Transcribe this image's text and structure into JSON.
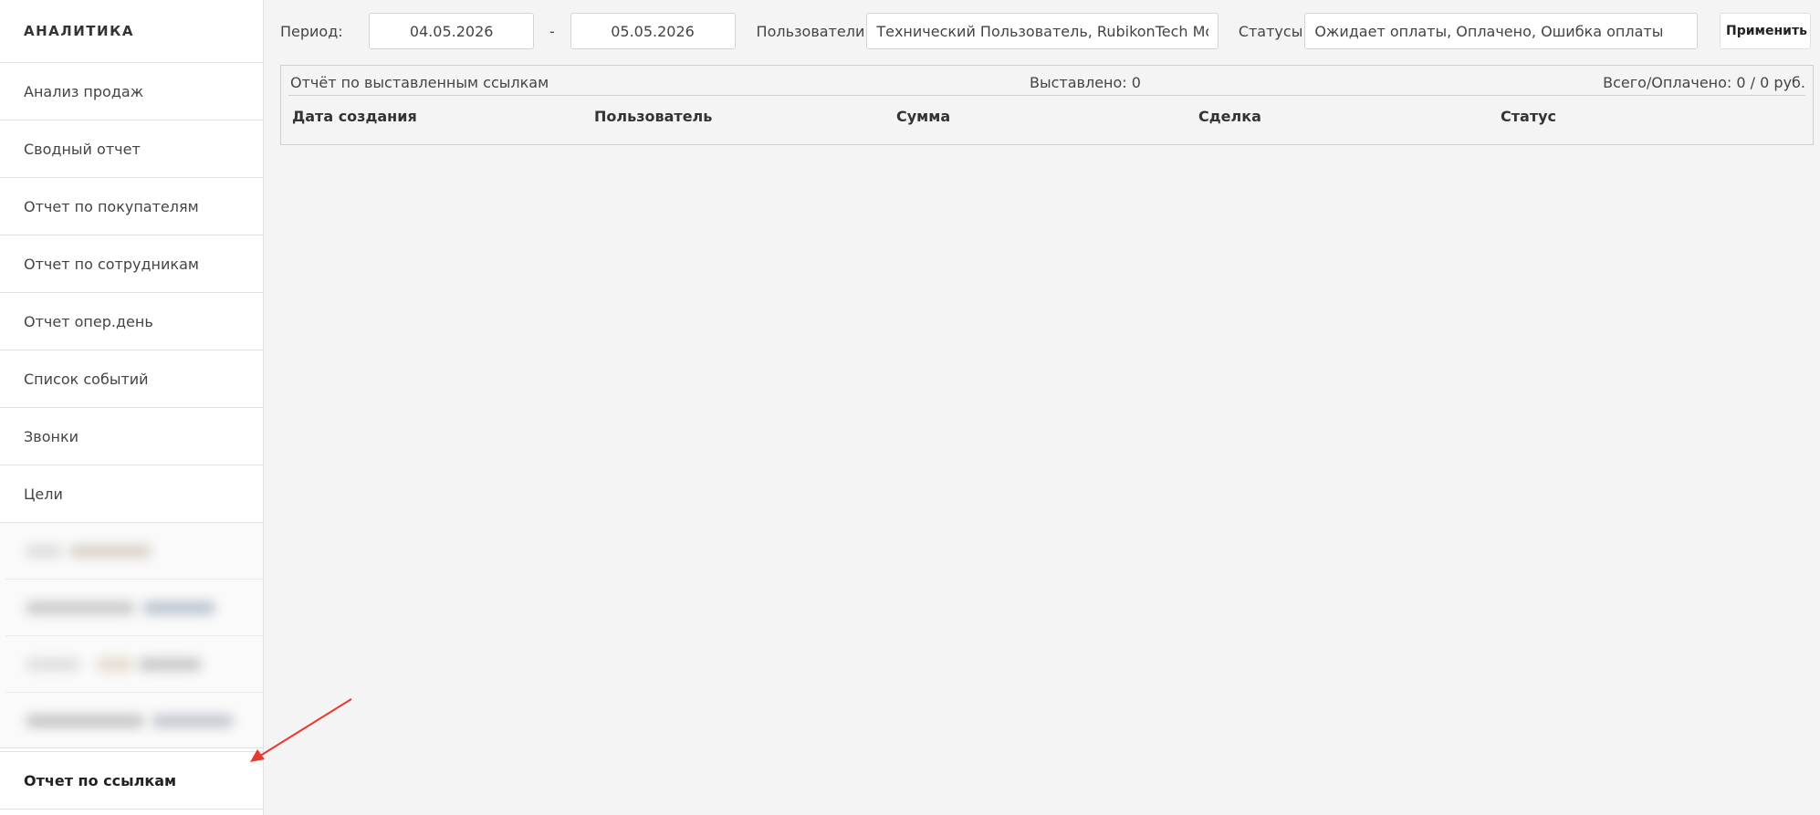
{
  "sidebar": {
    "title": "АНАЛИТИКА",
    "items": [
      {
        "label": "Анализ продаж"
      },
      {
        "label": "Сводный отчет"
      },
      {
        "label": "Отчет по покупателям"
      },
      {
        "label": "Отчет по сотрудникам"
      },
      {
        "label": "Отчет опер.день"
      },
      {
        "label": "Список событий"
      },
      {
        "label": "Звонки"
      },
      {
        "label": "Цели"
      }
    ],
    "active_item": {
      "label": "Отчет по ссылкам"
    }
  },
  "filters": {
    "period_label": "Период:",
    "date_from": "04.05.2026",
    "separator": "-",
    "date_to": "05.05.2026",
    "users_label": "Пользователи",
    "users_value": "Технический Пользователь, RubikonTech Модерация",
    "statuses_label": "Статусы",
    "statuses_value": "Ожидает оплаты, Оплачено, Ошибка оплаты",
    "apply_label": "Применить"
  },
  "report": {
    "title": "Отчёт по выставленным ссылкам",
    "issued": "Выставлено: 0",
    "total": "Всего/Оплачено: 0 / 0 руб.",
    "columns": [
      "Дата создания",
      "Пользователь",
      "Сумма",
      "Сделка",
      "Статус"
    ]
  },
  "colors": {
    "background": "#f4f4f4",
    "sidebar_bg": "#ffffff",
    "annotation_arrow": "#e8392f"
  }
}
